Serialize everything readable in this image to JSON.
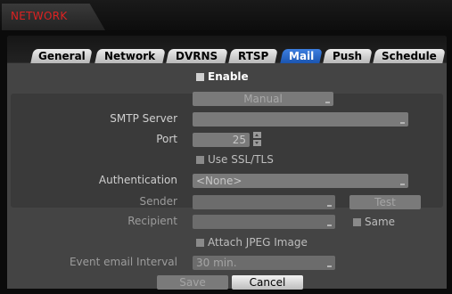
{
  "window": {
    "title": "NETWORK"
  },
  "tabs": [
    {
      "label": "General",
      "active": false
    },
    {
      "label": "Network",
      "active": false
    },
    {
      "label": "DVRNS",
      "active": false
    },
    {
      "label": "RTSP",
      "active": false
    },
    {
      "label": "Mail",
      "active": true
    },
    {
      "label": "Push",
      "active": false
    },
    {
      "label": "Schedule",
      "active": false
    }
  ],
  "form": {
    "enable_label": "Enable",
    "mode": "Manual",
    "smtp_server_label": "SMTP Server",
    "smtp_server_value": "",
    "port_label": "Port",
    "port_value": "25",
    "ssl_label": "Use SSL/TLS",
    "auth_label": "Authentication",
    "auth_value": "<None>",
    "sender_label": "Sender",
    "sender_value": "",
    "test_label": "Test",
    "recipient_label": "Recipient",
    "recipient_value": "",
    "same_label": "Same",
    "attach_label": "Attach JPEG Image",
    "interval_label": "Event email Interval",
    "interval_value": "30 min."
  },
  "buttons": {
    "save": "Save",
    "cancel": "Cancel"
  },
  "colors": {
    "title": "#dd2222",
    "active_tab": "#2a66c8"
  }
}
